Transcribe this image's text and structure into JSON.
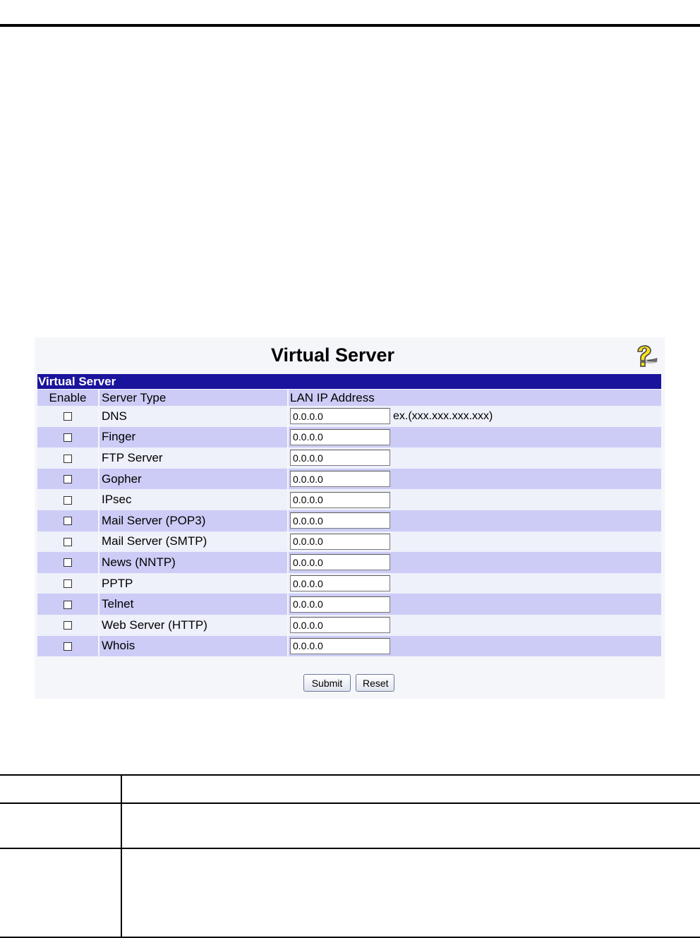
{
  "panel": {
    "title": "Virtual Server",
    "section_label": "Virtual Server",
    "help_icon": "help-question-icon"
  },
  "table": {
    "headers": {
      "enable": "Enable",
      "server_type": "Server Type",
      "lan_ip": "LAN IP Address"
    },
    "ip_hint": "ex.(xxx.xxx.xxx.xxx)",
    "rows": [
      {
        "server_type": "DNS",
        "ip": "0.0.0.0",
        "enabled": false
      },
      {
        "server_type": "Finger",
        "ip": "0.0.0.0",
        "enabled": false
      },
      {
        "server_type": "FTP Server",
        "ip": "0.0.0.0",
        "enabled": false
      },
      {
        "server_type": "Gopher",
        "ip": "0.0.0.0",
        "enabled": false
      },
      {
        "server_type": "IPsec",
        "ip": "0.0.0.0",
        "enabled": false
      },
      {
        "server_type": "Mail Server (POP3)",
        "ip": "0.0.0.0",
        "enabled": false
      },
      {
        "server_type": "Mail Server (SMTP)",
        "ip": "0.0.0.0",
        "enabled": false
      },
      {
        "server_type": "News (NNTP)",
        "ip": "0.0.0.0",
        "enabled": false
      },
      {
        "server_type": "PPTP",
        "ip": "0.0.0.0",
        "enabled": false
      },
      {
        "server_type": "Telnet",
        "ip": "0.0.0.0",
        "enabled": false
      },
      {
        "server_type": "Web Server (HTTP)",
        "ip": "0.0.0.0",
        "enabled": false
      },
      {
        "server_type": "Whois",
        "ip": "0.0.0.0",
        "enabled": false
      }
    ]
  },
  "buttons": {
    "submit": "Submit",
    "reset": "Reset"
  },
  "colors": {
    "section_bar": "#1a139c",
    "row_alt": "#ccccf6",
    "row": "#eef0fa"
  }
}
